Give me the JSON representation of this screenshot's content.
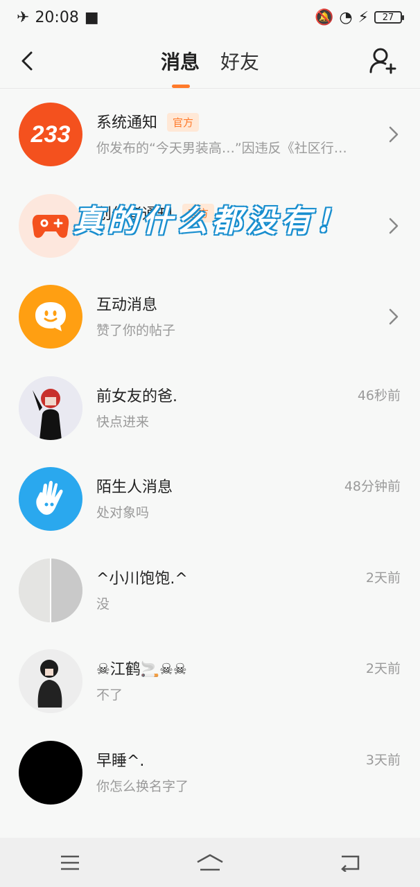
{
  "statusbar": {
    "time": "20:08",
    "battery": "27"
  },
  "header": {
    "tabs": [
      {
        "label": "消息",
        "active": true
      },
      {
        "label": "好友",
        "active": false
      }
    ]
  },
  "overlay_text": "真的什么都没有！",
  "conversations": [
    {
      "name": "系统通知",
      "badge": "官方",
      "preview": "你发布的“今天男装高…”因违反《社区行…",
      "time": "",
      "avatar_text": "233"
    },
    {
      "name": "创作者通知",
      "badge": "官方",
      "preview": "",
      "time": ""
    },
    {
      "name": "互动消息",
      "badge": "",
      "preview": "赞了你的帖子",
      "time": ""
    },
    {
      "name": "前女友的爸.",
      "preview": "快点进来",
      "time": "46秒前"
    },
    {
      "name": "陌生人消息",
      "preview": "处对象吗",
      "time": "48分钟前"
    },
    {
      "name": "^小川饱饱.^",
      "preview": "没",
      "time": "2天前"
    },
    {
      "name": "☠江鹤🚬☠☠",
      "preview": "不了",
      "time": "2天前"
    },
    {
      "name": "早睡^.",
      "preview": "你怎么换名字了",
      "time": "3天前"
    }
  ],
  "colors": {
    "accent": "#ff7a2a",
    "system_avatar": "#f4511e",
    "interact_avatar": "#ff9f12",
    "stranger_avatar": "#2aa8ee"
  }
}
